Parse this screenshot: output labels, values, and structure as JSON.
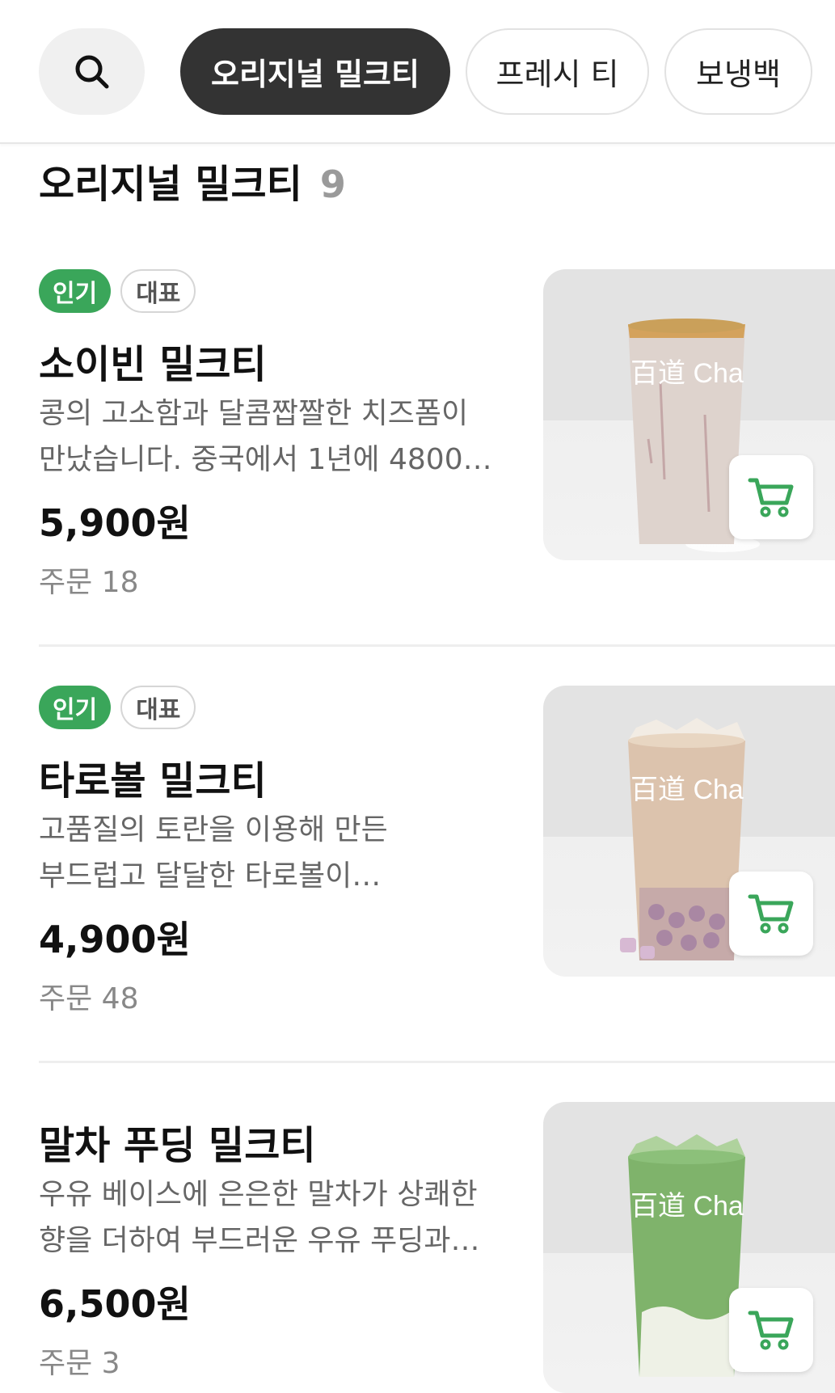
{
  "header": {
    "search_icon": "search-icon",
    "categories": [
      {
        "label": "오리지널 밀크티",
        "active": true
      },
      {
        "label": "프레시 티",
        "active": false
      },
      {
        "label": "보냉백",
        "active": false
      }
    ]
  },
  "section": {
    "title": "오리지널 밀크티",
    "count": "9"
  },
  "items": [
    {
      "badges": [
        "인기",
        "대표"
      ],
      "name": "소이빈 밀크티",
      "description": "콩의 고소함과 달콤짭짤한 치즈폼이 만났습니다. 중국에서 1년에 4800…",
      "price": "5,900원",
      "orders": "주문 18",
      "image_text": "百道 Cha",
      "drink_color": "#d9cdc6"
    },
    {
      "badges": [
        "인기",
        "대표"
      ],
      "name": "타로볼 밀크티",
      "description": "고품질의 토란을 이용해 만든 부드럽고 달달한 타로볼이 들어갑니다. 신…",
      "price": "4,900원",
      "orders": "주문 48",
      "image_text": "百道 Cha",
      "drink_color": "#dcc3ad"
    },
    {
      "badges": [],
      "name": "말차 푸딩 밀크티",
      "description": "우유 베이스에 은은한 말차가 상쾌한 향을 더하여 부드러운 우유 푸딩과…",
      "price": "6,500원",
      "orders": "주문 3",
      "image_text": "百道 Cha",
      "drink_color": "#7fb36b"
    }
  ],
  "colors": {
    "accent": "#3aa65a",
    "chip_active": "#333333"
  }
}
